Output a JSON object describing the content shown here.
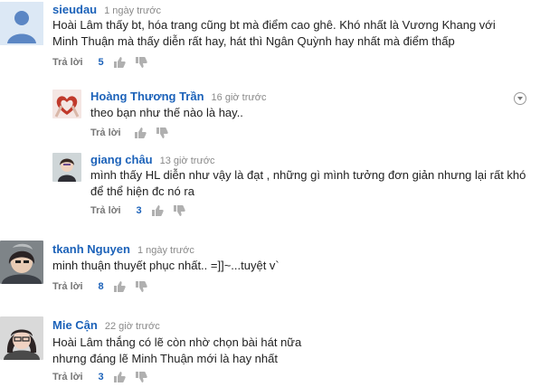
{
  "labels": {
    "reply": "Trả lời"
  },
  "comments": [
    {
      "author": "sieudau",
      "time": "1 ngày trước",
      "lines": [
        "Hoài Lâm thấy bt, hóa trang cũng bt mà điểm cao ghê. Khó nhất là Vương Khang với",
        "Minh Thuận mà thấy diễn rất hay, hát thì Ngân Quỳnh hay nhất mà điểm thấp"
      ],
      "likes": "5"
    },
    {
      "author": "Hoàng Thương Trần",
      "time": "16 giờ trước",
      "lines": [
        "theo bạn như thế nào là hay.."
      ],
      "likes": ""
    },
    {
      "author": "giang châu",
      "time": "13 giờ trước",
      "lines": [
        "mình thấy HL diễn như vậy là đạt , những gì mình tưởng đơn giản nhưng lại rất khó",
        "để thể hiện đc nó ra"
      ],
      "likes": "3"
    },
    {
      "author": "tkanh Nguyen",
      "time": "1 ngày trước",
      "lines": [
        "minh thuận thuyết phục nhất.. =]]~...tuyệt v`"
      ],
      "likes": "8"
    },
    {
      "author": "Mie Cận",
      "time": "22 giờ trước",
      "lines": [
        "Hoài Lâm thắng có lẽ còn nhờ chọn bài hát nữa",
        "nhưng đáng lẽ Minh Thuận mới là hay nhất"
      ],
      "likes": "3"
    }
  ]
}
